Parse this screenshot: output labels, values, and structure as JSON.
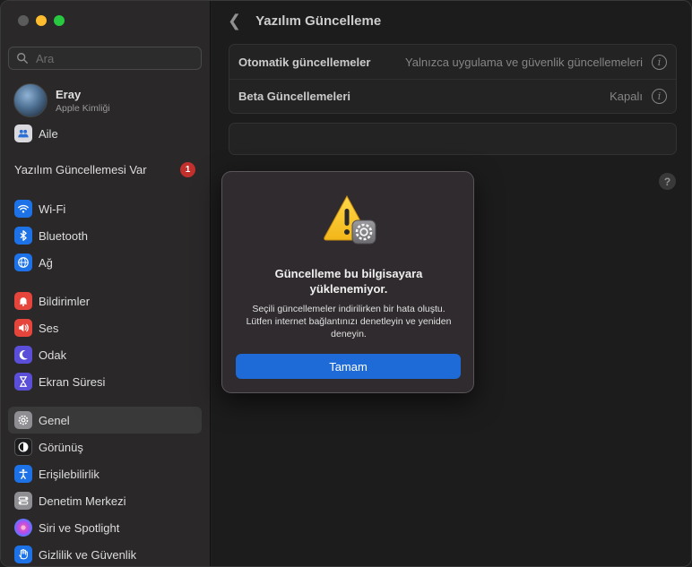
{
  "sidebar": {
    "search_placeholder": "Ara",
    "account": {
      "name": "Eray",
      "subtitle": "Apple Kimliği"
    },
    "family": "Aile",
    "update_notice": {
      "label": "Yazılım Güncellemesi Var",
      "count": "1"
    },
    "items": [
      {
        "label": "Wi-Fi",
        "icon": "wifi-icon",
        "color": "#1d72e8"
      },
      {
        "label": "Bluetooth",
        "icon": "bluetooth-icon",
        "color": "#1d72e8"
      },
      {
        "label": "Ağ",
        "icon": "globe-icon",
        "color": "#1d72e8"
      },
      {
        "label": "Bildirimler",
        "icon": "bell-icon",
        "color": "#e5453b"
      },
      {
        "label": "Ses",
        "icon": "speaker-icon",
        "color": "#e5453b"
      },
      {
        "label": "Odak",
        "icon": "moon-icon",
        "color": "#5b4fd9"
      },
      {
        "label": "Ekran Süresi",
        "icon": "hourglass-icon",
        "color": "#5b4fd9"
      },
      {
        "label": "Genel",
        "icon": "gear-icon",
        "color": "#8e8e93"
      },
      {
        "label": "Görünüş",
        "icon": "appearance-icon",
        "color": "#1c1c1e"
      },
      {
        "label": "Erişilebilirlik",
        "icon": "accessibility-icon",
        "color": "#1d72e8"
      },
      {
        "label": "Denetim Merkezi",
        "icon": "control-center-icon",
        "color": "#8e8e93"
      },
      {
        "label": "Siri ve Spotlight",
        "icon": "siri-icon",
        "color": "#c03cf0"
      },
      {
        "label": "Gizlilik ve Güvenlik",
        "icon": "hand-icon",
        "color": "#1d72e8"
      }
    ],
    "selected": "Genel"
  },
  "main": {
    "title": "Yazılım Güncelleme",
    "rows": [
      {
        "label": "Otomatik güncellemeler",
        "value": "Yalnızca uygulama ve güvenlik güncellemeleri"
      },
      {
        "label": "Beta Güncellemeleri",
        "value": "Kapalı"
      }
    ],
    "help": "?"
  },
  "dialog": {
    "title": "Güncelleme bu bilgisayara yüklenemiyor.",
    "message": "Seçili güncellemeler indirilirken bir hata oluştu. Lütfen internet bağlantınızı denetleyin ve yeniden deneyin.",
    "button": "Tamam",
    "icon": "warning-gear-icon",
    "accent": "#1e6ad6"
  }
}
